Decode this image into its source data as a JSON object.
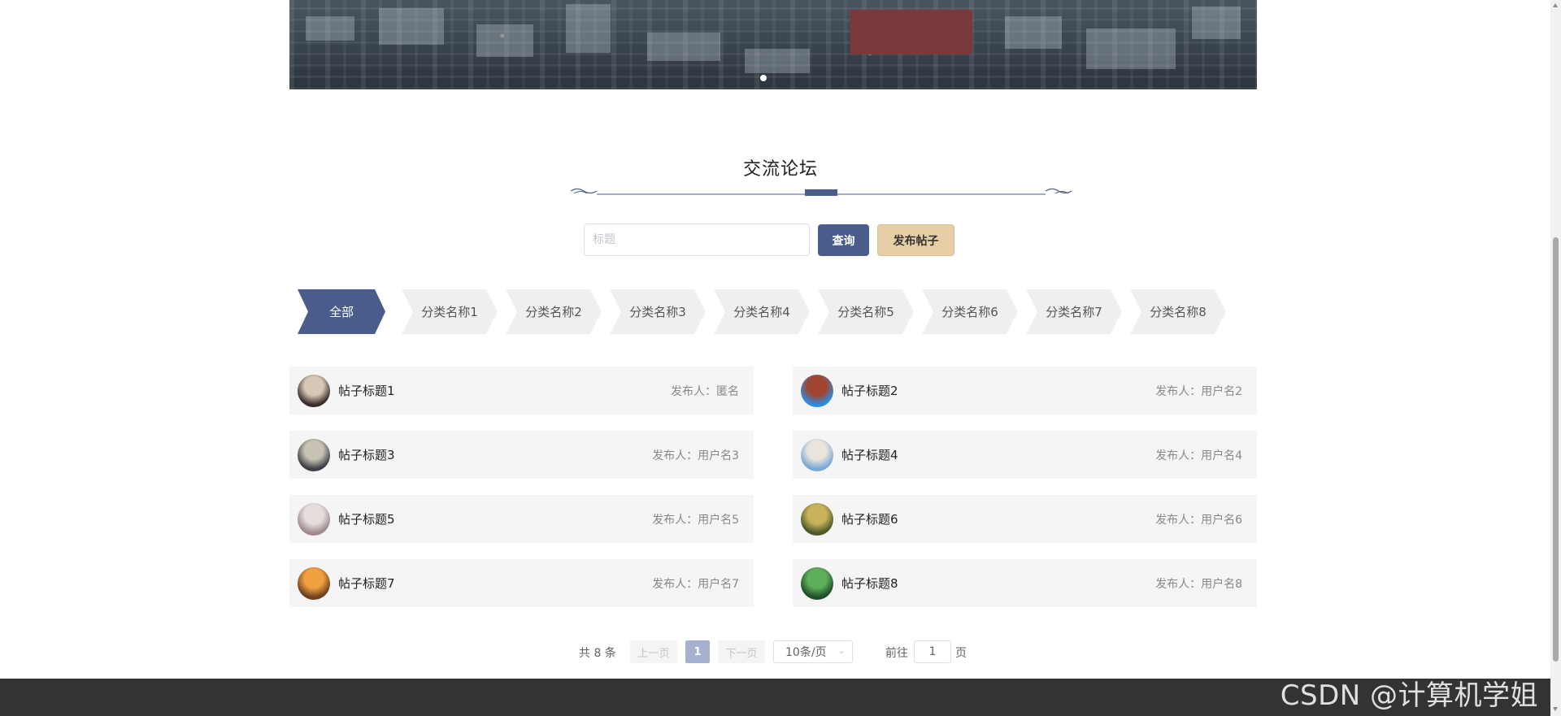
{
  "banner": {
    "slide_count": 1
  },
  "section": {
    "title": "交流论坛"
  },
  "search": {
    "placeholder": "标题",
    "value": "",
    "query_label": "查询",
    "publish_label": "发布帖子"
  },
  "categories": [
    {
      "label": "全部",
      "active": true
    },
    {
      "label": "分类名称1",
      "active": false
    },
    {
      "label": "分类名称2",
      "active": false
    },
    {
      "label": "分类名称3",
      "active": false
    },
    {
      "label": "分类名称4",
      "active": false
    },
    {
      "label": "分类名称5",
      "active": false
    },
    {
      "label": "分类名称6",
      "active": false
    },
    {
      "label": "分类名称7",
      "active": false
    },
    {
      "label": "分类名称8",
      "active": false
    }
  ],
  "author_prefix": "发布人：",
  "posts": [
    {
      "title": "帖子标题1",
      "author": "匿名",
      "avatar_colors": [
        "#3a2c2a",
        "#d8c7b5"
      ]
    },
    {
      "title": "帖子标题2",
      "author": "用户名2",
      "avatar_colors": [
        "#2c8ce0",
        "#a04530"
      ]
    },
    {
      "title": "帖子标题3",
      "author": "用户名3",
      "avatar_colors": [
        "#3b3f46",
        "#c7c2b4"
      ]
    },
    {
      "title": "帖子标题4",
      "author": "用户名4",
      "avatar_colors": [
        "#7aa9d6",
        "#e9e4dc"
      ]
    },
    {
      "title": "帖子标题5",
      "author": "用户名5",
      "avatar_colors": [
        "#a08a8c",
        "#e6dede"
      ]
    },
    {
      "title": "帖子标题6",
      "author": "用户名6",
      "avatar_colors": [
        "#4a5a2a",
        "#c8b25a"
      ]
    },
    {
      "title": "帖子标题7",
      "author": "用户名7",
      "avatar_colors": [
        "#6a4020",
        "#f0a040"
      ]
    },
    {
      "title": "帖子标题8",
      "author": "用户名8",
      "avatar_colors": [
        "#1e4d2a",
        "#5fae5a"
      ]
    }
  ],
  "pagination": {
    "total_text": "共 8 条",
    "prev_label": "上一页",
    "current_page": "1",
    "next_label": "下一页",
    "page_size_label": "10条/页",
    "goto_label": "前往",
    "goto_value": "1",
    "page_unit": "页"
  },
  "watermark": "CSDN @计算机学姐"
}
